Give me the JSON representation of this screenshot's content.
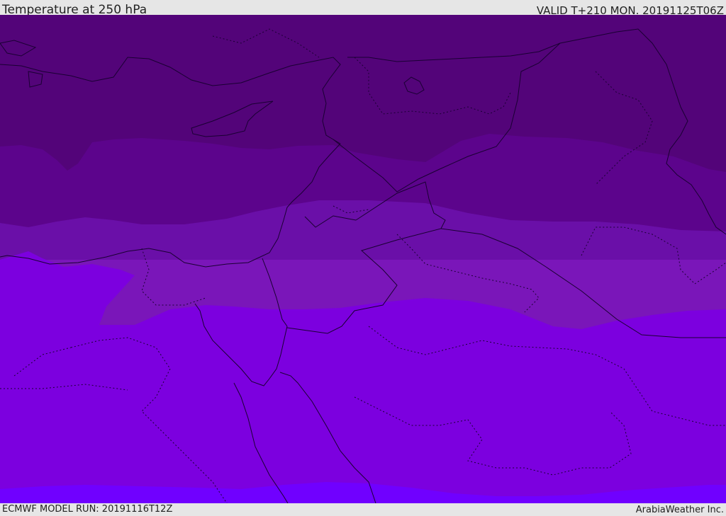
{
  "header": {
    "title": "Temperature at 250 hPa",
    "valid_time": "VALID T+210 MON. 20191125T06Z"
  },
  "footer": {
    "model_run": "ECMWF MODEL RUN: 20191116T12Z",
    "credit": "ArabiaWeather Inc."
  },
  "map": {
    "fill_colors": [
      "#530479",
      "#5c048c",
      "#6a0fa8",
      "#7a16b9",
      "#7c00df",
      "#7000ff"
    ],
    "border_color": "#1a0033"
  }
}
